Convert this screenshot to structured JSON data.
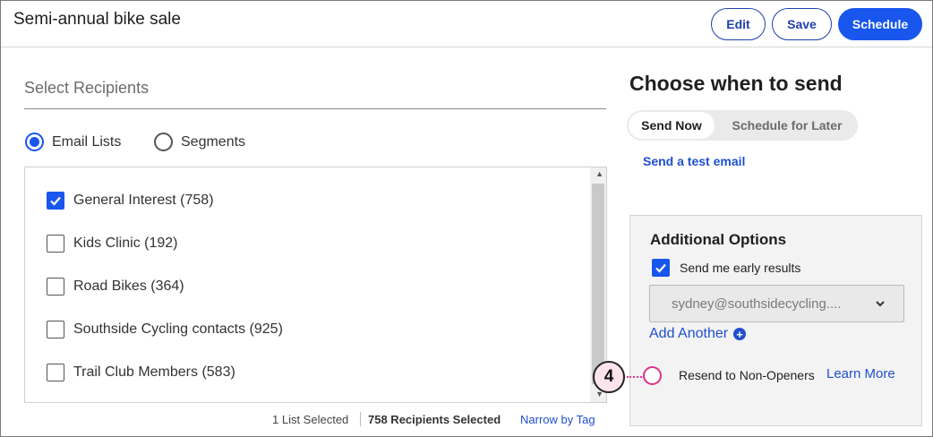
{
  "header": {
    "title": "Semi-annual bike sale",
    "edit_label": "Edit",
    "save_label": "Save",
    "schedule_label": "Schedule"
  },
  "recipients": {
    "title": "Select Recipients",
    "radio_options": [
      {
        "label": "Email Lists",
        "selected": true
      },
      {
        "label": "Segments",
        "selected": false
      }
    ],
    "lists": [
      {
        "label": "General Interest (758)",
        "checked": true
      },
      {
        "label": "Kids Clinic (192)",
        "checked": false
      },
      {
        "label": "Road Bikes (364)",
        "checked": false
      },
      {
        "label": "Southside Cycling contacts (925)",
        "checked": false
      },
      {
        "label": "Trail Club Members (583)",
        "checked": false
      }
    ],
    "footer": {
      "lists_selected": "1 List Selected",
      "recipients_selected": "758 Recipients Selected",
      "narrow_link": "Narrow by Tag"
    }
  },
  "send": {
    "title": "Choose when to send",
    "toggle_now": "Send Now",
    "toggle_later": "Schedule for Later",
    "test_link": "Send a test email"
  },
  "options": {
    "title": "Additional Options",
    "early_results_label": "Send me early results",
    "early_results_checked": true,
    "email_value": "sydney@southsidecycling....",
    "add_another": "Add Another",
    "resend_label": "Resend to Non-Openers",
    "learn_more": "Learn More"
  },
  "callout": {
    "number": "4"
  },
  "colors": {
    "primary": "#1856ed",
    "link": "#1f4fcf",
    "callout": "#e0318a"
  }
}
